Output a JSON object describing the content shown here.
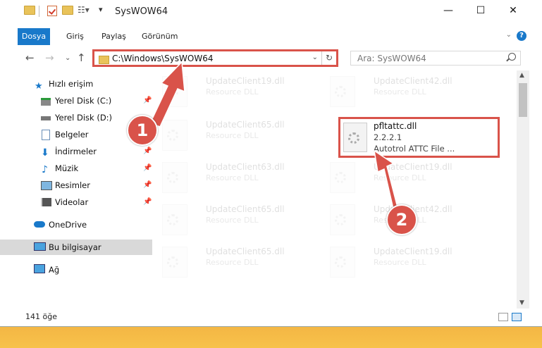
{
  "window": {
    "title": "SysWOW64"
  },
  "ribbon": {
    "tabs": [
      {
        "label": "Dosya",
        "active": true
      },
      {
        "label": "Giriş"
      },
      {
        "label": "Paylaş"
      },
      {
        "label": "Görünüm"
      }
    ],
    "help": "?"
  },
  "nav": {
    "address": "C:\\Windows\\SysWOW64",
    "search_placeholder": "Ara: SysWOW64"
  },
  "sidebar": {
    "items": [
      {
        "label": "Hızlı erişim",
        "icon": "star-icon"
      },
      {
        "label": "Yerel Disk (C:)",
        "icon": "drive-icon",
        "pinned": true
      },
      {
        "label": "Yerel Disk (D:)",
        "icon": "drive-icon"
      },
      {
        "label": "Belgeler",
        "icon": "documents-icon"
      },
      {
        "label": "İndirmeler",
        "icon": "download-icon",
        "pinned": true
      },
      {
        "label": "Müzik",
        "icon": "music-icon",
        "pinned": true
      },
      {
        "label": "Resimler",
        "icon": "pictures-icon",
        "pinned": true
      },
      {
        "label": "Videolar",
        "icon": "video-icon",
        "pinned": true
      },
      {
        "label": "OneDrive",
        "icon": "cloud-icon"
      },
      {
        "label": "Bu bilgisayar",
        "icon": "computer-icon",
        "selected": true
      },
      {
        "label": "Ağ",
        "icon": "network-icon"
      }
    ]
  },
  "files": {
    "faded": [
      {
        "name": "UpdateClient19.dll",
        "desc": "Resource DLL"
      },
      {
        "name": "UpdateClient42.dll",
        "desc": "Resource DLL"
      },
      {
        "name": "UpdateClient65.dll",
        "desc": "Resource DLL"
      },
      {
        "name": "UpdateClient63.dll",
        "desc": "Resource DLL"
      },
      {
        "name": "UpdateClient19.dll",
        "desc": "Resource DLL"
      },
      {
        "name": "UpdateClient65.dll",
        "desc": "Resource DLL"
      },
      {
        "name": "UpdateClient42.dll",
        "desc": "Resource DLL"
      },
      {
        "name": "UpdateClient65.dll",
        "desc": "Resource DLL"
      },
      {
        "name": "UpdateClient19.dll",
        "desc": "Resource DLL"
      }
    ],
    "highlighted": {
      "name": "pfltattc.dll",
      "version": "2.2.2.1",
      "desc": "Autotrol ATTC File ..."
    }
  },
  "status": {
    "count": "141 öğe"
  },
  "annotations": {
    "step1": "1",
    "step2": "2",
    "color": "#d9534a"
  }
}
